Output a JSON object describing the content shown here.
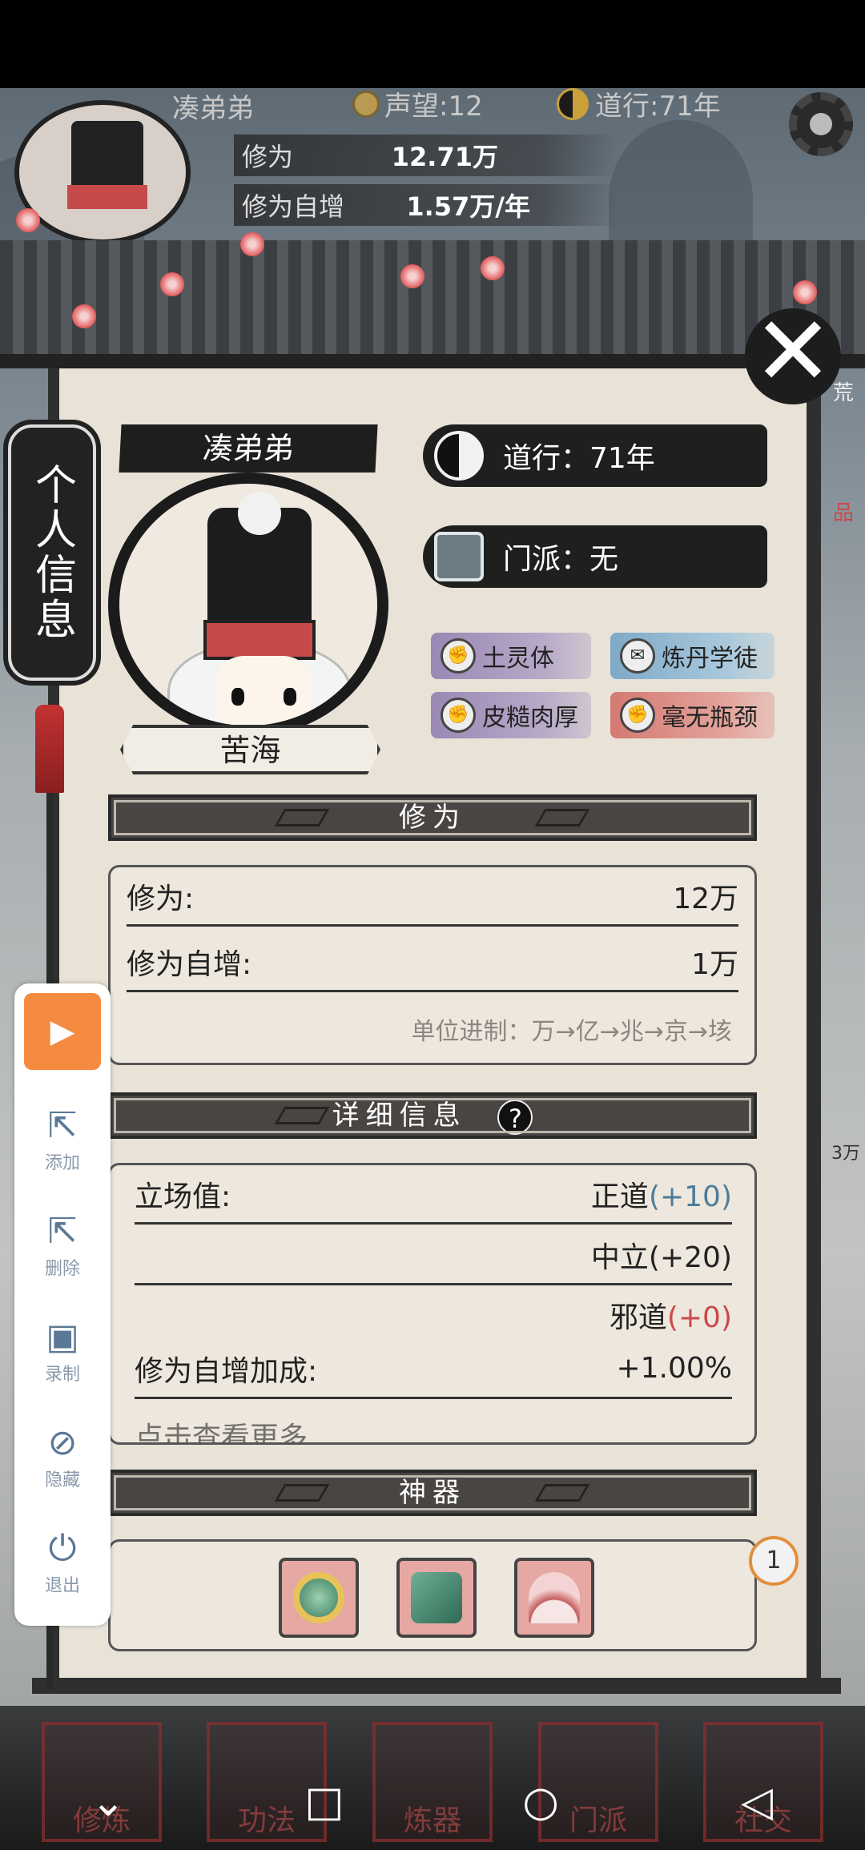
{
  "header": {
    "player_name": "凑弟弟",
    "fame": "声望:12",
    "dao_years": "道行:71年",
    "cultivation_label": "修为",
    "cultivation_value": "12.71万",
    "growth_label": "修为自增",
    "growth_value": "1.57万/年"
  },
  "side_tab": {
    "label": "个人信息"
  },
  "profile": {
    "name": "凑弟弟",
    "realm": "苦海",
    "dao": "道行：71年",
    "sect": "门派：无",
    "traits": [
      {
        "label": "土灵体",
        "color": "purple",
        "icon": "fist-icon"
      },
      {
        "label": "炼丹学徒",
        "color": "blue",
        "icon": "scroll-icon"
      },
      {
        "label": "皮糙肉厚",
        "color": "purple",
        "icon": "fist-icon"
      },
      {
        "label": "毫无瓶颈",
        "color": "red",
        "icon": "fist-icon"
      }
    ]
  },
  "cultivation_section": {
    "title": "修为",
    "rows": [
      {
        "label": "修为:",
        "value": "12万"
      },
      {
        "label": "修为自增:",
        "value": "1万"
      }
    ],
    "hint": "单位进制：万→亿→兆→京→垓"
  },
  "detail_section": {
    "title": "详细信息",
    "help": "?",
    "stance_label": "立场值:",
    "stance_righteous": "正道",
    "stance_righteous_val": "(+10)",
    "stance_neutral": "中立(+20)",
    "stance_evil": "邪道",
    "stance_evil_val": "(+0)",
    "bonus_label": "修为自增加成:",
    "bonus_value": "+1.00%",
    "cut_row": "点击查看更多"
  },
  "artifact_section": {
    "title": "神器",
    "items": [
      "jade-ring-icon",
      "jade-pendant-icon",
      "fan-icon"
    ],
    "badge": "1"
  },
  "right_edge": {
    "a": "荒",
    "b": "品",
    "c": "3万"
  },
  "bottom_nav": [
    "修炼",
    "功法",
    "炼器",
    "门派",
    "社交"
  ],
  "recorder": {
    "play_icon": "▶",
    "items": [
      {
        "label": "添加",
        "icon": "cursor-plus-icon"
      },
      {
        "label": "删除",
        "icon": "cursor-minus-icon"
      },
      {
        "label": "录制",
        "icon": "video-icon"
      },
      {
        "label": "隐藏",
        "icon": "eye-off-icon"
      },
      {
        "label": "退出",
        "icon": "power-icon"
      }
    ]
  },
  "system_nav": [
    "chevron-down-icon",
    "square-icon",
    "circle-icon",
    "back-triangle-icon"
  ]
}
